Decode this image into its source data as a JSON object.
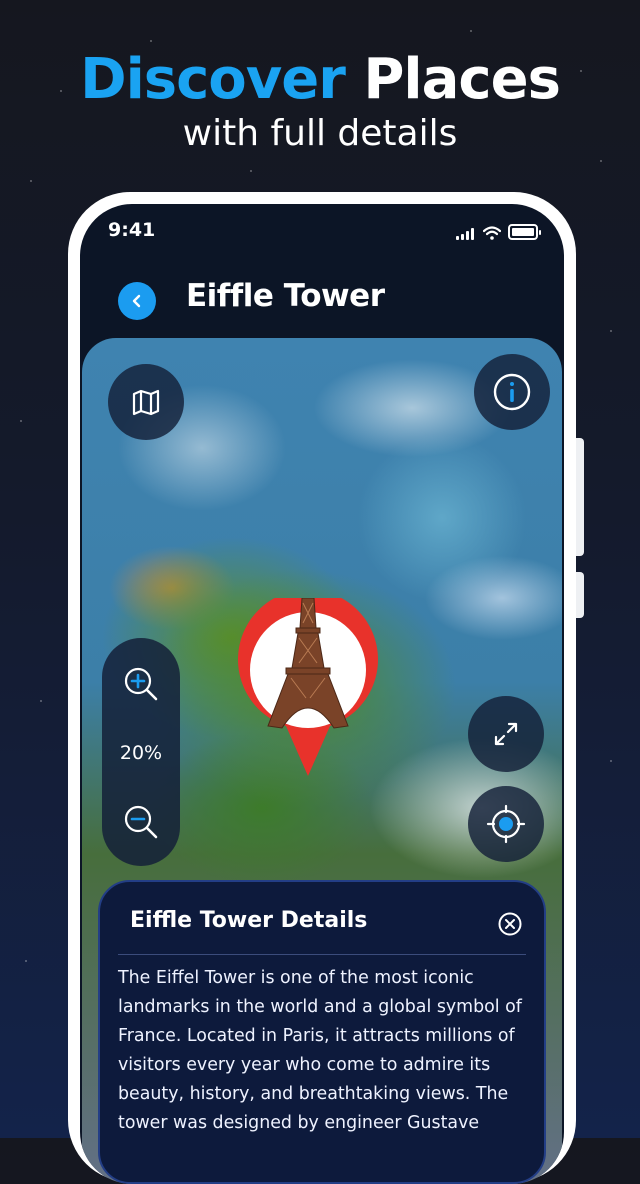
{
  "promo": {
    "headline_accent": "Discover",
    "headline_rest": "Places",
    "subheadline": "with full details"
  },
  "status_bar": {
    "time": "9:41"
  },
  "header": {
    "title": "Eiffle Tower"
  },
  "map": {
    "zoom_level": "20%",
    "marker": "eiffel-tower-pin"
  },
  "details": {
    "title": "Eiffle Tower Details",
    "description": "The Eiffel Tower is one of the most iconic landmarks in the world and a global symbol of France. Located in Paris, it attracts millions of visitors every year who come to admire its beauty, history, and breathtaking views. The tower was designed by engineer Gustave"
  },
  "colors": {
    "accent": "#1aa3f2",
    "pin": "#e8322b",
    "panel": "#0d1a3c"
  },
  "icons": [
    "map-icon",
    "info-icon",
    "zoom-in-icon",
    "zoom-out-icon",
    "expand-icon",
    "locate-icon",
    "back-chevron-icon",
    "close-icon"
  ]
}
